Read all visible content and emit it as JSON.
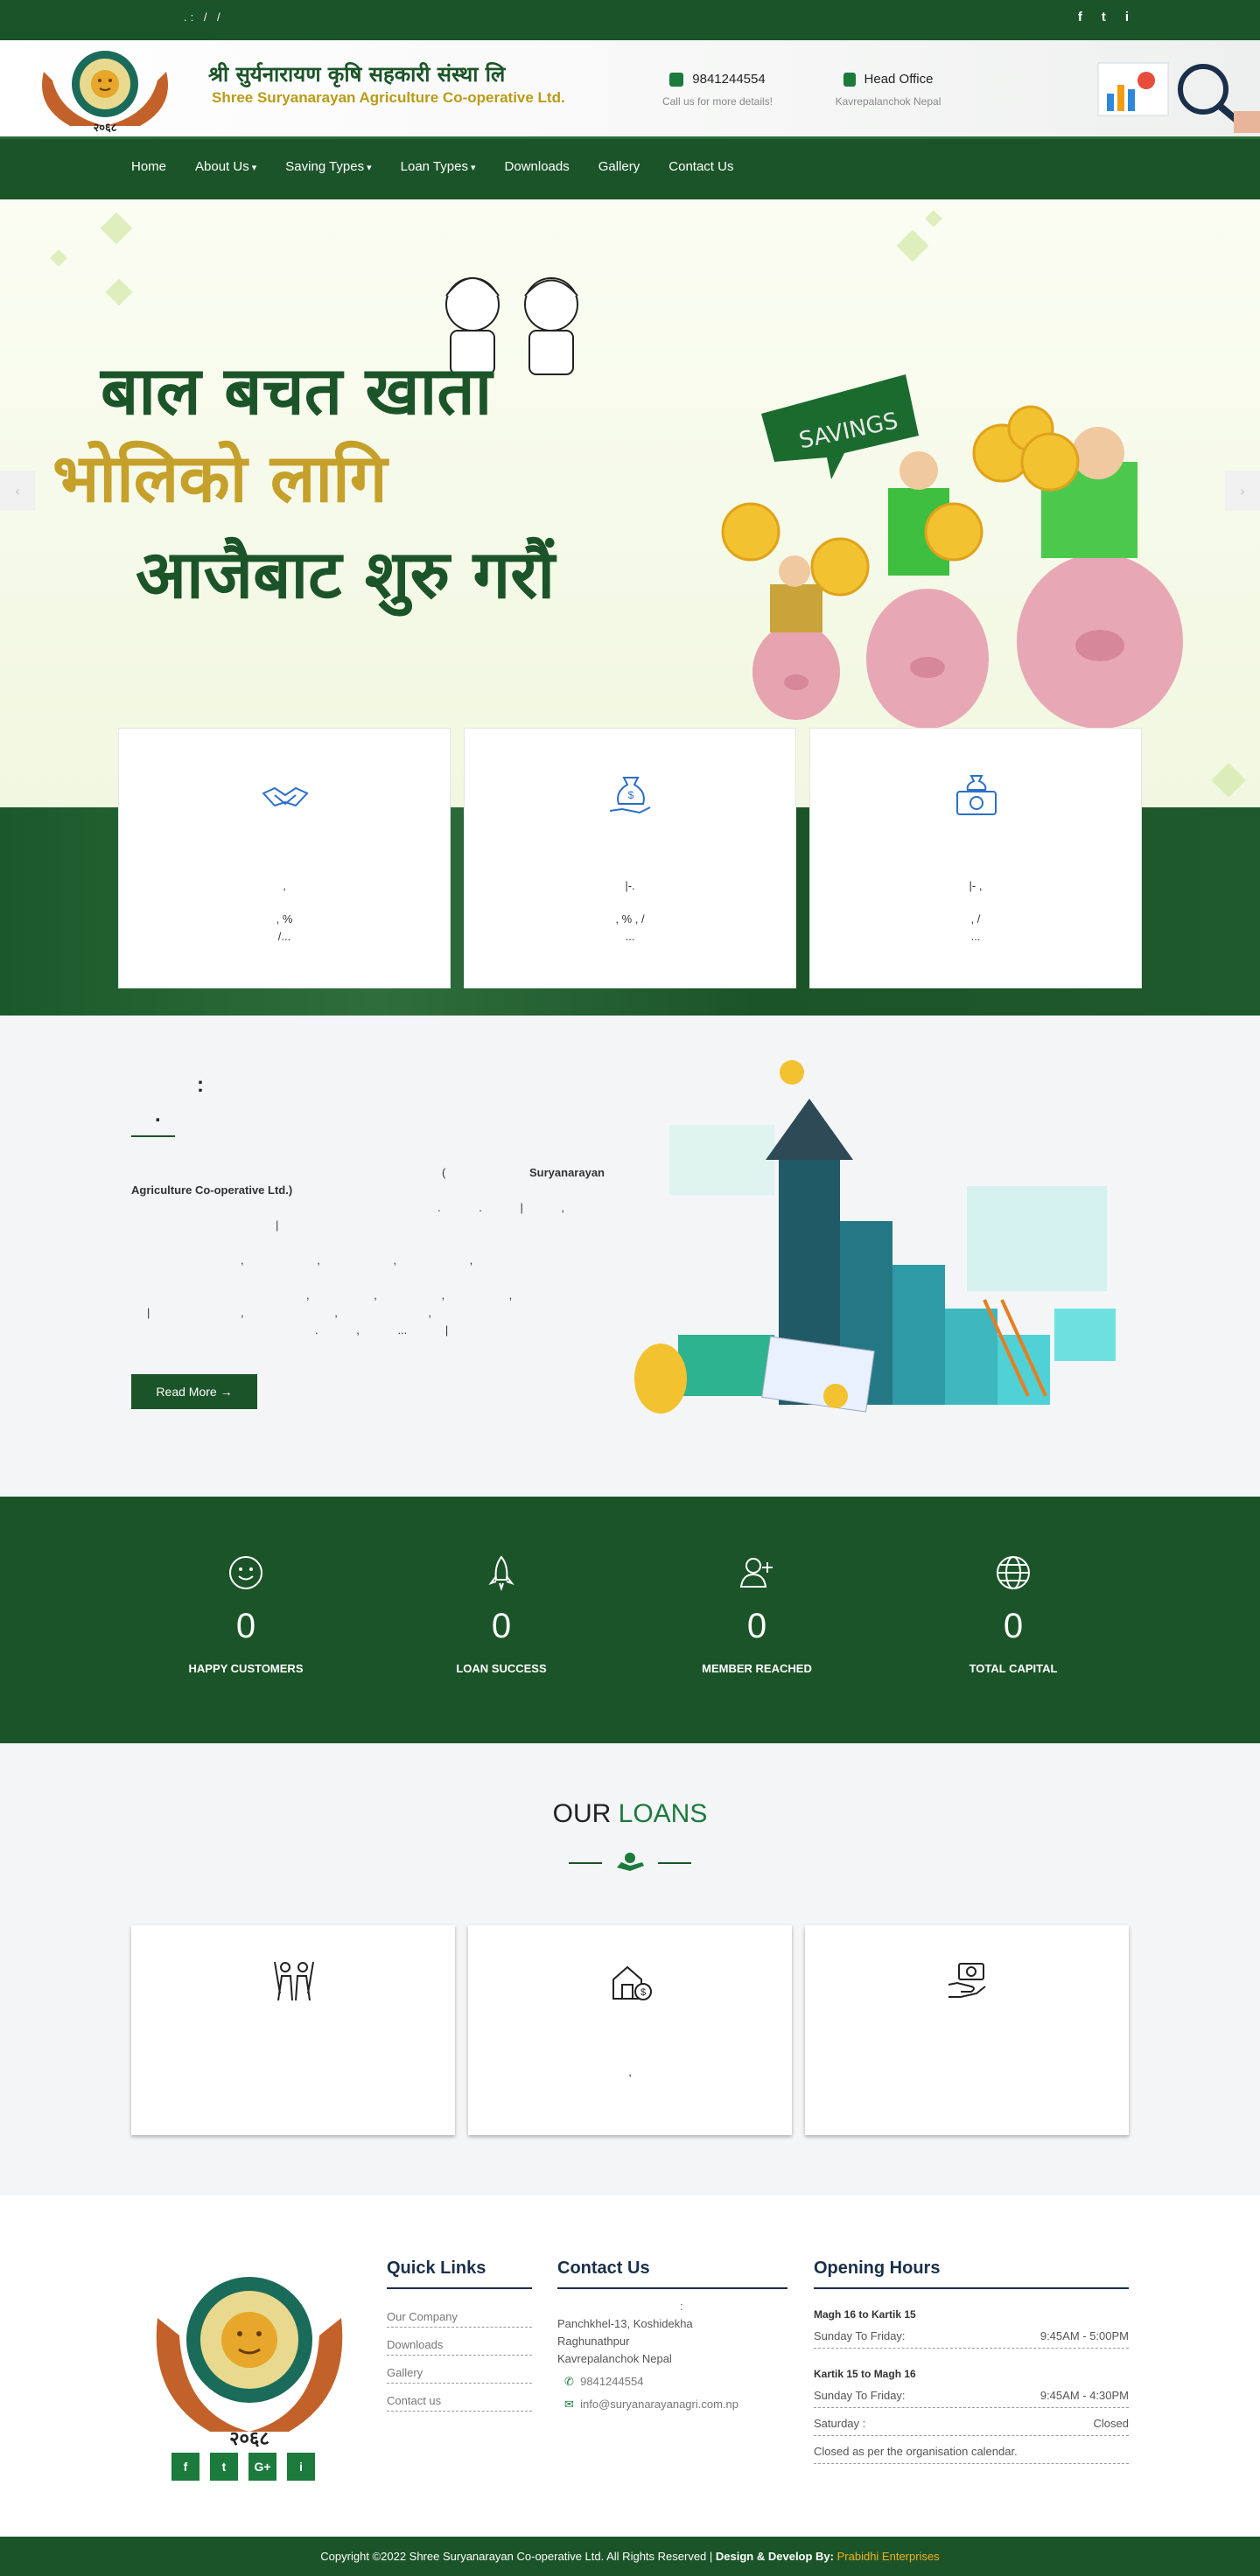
{
  "topbar": {
    "info": ".: / /",
    "social": [
      "f",
      "t",
      "i"
    ]
  },
  "header": {
    "brand_np": "श्री सुर्यनारायण कृषि सहकारी संस्था लि",
    "brand_en": "Shree Suryanarayan Agriculture Co-operative Ltd.",
    "logo_year": "२०६८",
    "phone": "9841244554",
    "phone_sub": "Call us for more details!",
    "office": "Head Office",
    "office_sub": "Kavrepalanchok Nepal"
  },
  "nav": [
    "Home",
    "About Us",
    "Saving Types",
    "Loan Types",
    "Downloads",
    "Gallery",
    "Contact Us"
  ],
  "hero": {
    "line1": "बाल बचत खाता",
    "line2": "भोलिको लागि",
    "line3": "आजैबाट शुरु गरौं",
    "sign": "SAVINGS",
    "prev": "‹",
    "next": "›"
  },
  "cards": [
    {
      "icon": "handshake-icon",
      "l1": ",",
      "l2": ", %",
      "l3": "/..."
    },
    {
      "icon": "money-bag-hand-icon",
      "l1": "|-.",
      "l2": ", % , /",
      "l3": "..."
    },
    {
      "icon": "money-stack-icon",
      "l1": "|- ,",
      "l2": ", /",
      "l3": "..."
    }
  ],
  "about": {
    "heading": ":",
    "heading2": ".",
    "p1a": "(",
    "p1b": "Suryanarayan",
    "p2": "Agriculture Co-operative Ltd.)",
    "p3": ". . | ,",
    "p4": "|",
    "p5": ", , , ,",
    "p6": ", , , ,",
    "p7": "| , , ,",
    "p8": ". , ... |",
    "button": "Read More →"
  },
  "stats": [
    {
      "icon": "smile-icon",
      "value": "0",
      "label": "HAPPY CUSTOMERS"
    },
    {
      "icon": "rocket-icon",
      "value": "0",
      "label": "LOAN SUCCESS"
    },
    {
      "icon": "user-plus-icon",
      "value": "0",
      "label": "MEMBER REACHED"
    },
    {
      "icon": "globe-icon",
      "value": "0",
      "label": "TOTAL CAPITAL"
    }
  ],
  "loans": {
    "heading_a": "OUR",
    "heading_b": "LOANS",
    "cards": [
      {
        "icon": "farmers-icon",
        "text": ""
      },
      {
        "icon": "house-loan-icon",
        "text": ","
      },
      {
        "icon": "hand-money-icon",
        "text": ""
      }
    ]
  },
  "footer": {
    "quick_title": "Quick Links",
    "quick": [
      "Our Company",
      "Downloads",
      "Gallery",
      "Contact us"
    ],
    "contact_title": "Contact Us",
    "contact_colon": ":",
    "address": [
      "Panchkhel-13, Koshidekha",
      "Raghunathpur",
      "Kavrepalanchok Nepal"
    ],
    "phone": "9841244554",
    "email": "info@suryanarayanagri.com.np",
    "hours_title": "Opening Hours",
    "period1": "Magh 16 to Kartik 15",
    "row1": {
      "k": "Sunday To Friday:",
      "v": "9:45AM - 5:00PM"
    },
    "period2": "Kartik 15 to Magh 16",
    "row2": {
      "k": "Sunday To Friday:",
      "v": "9:45AM - 4:30PM"
    },
    "row3": {
      "k": "Saturday :",
      "v": "Closed"
    },
    "note": "Closed as per the organisation calendar.",
    "social": [
      "f",
      "t",
      "G+",
      "i"
    ]
  },
  "bottom": {
    "copy": "Copyright ©2022 Shree Suryanarayan Co-operative Ltd. All Rights Reserved |",
    "dev": "Design & Develop By:",
    "company": "Prabidhi Enterprises"
  }
}
